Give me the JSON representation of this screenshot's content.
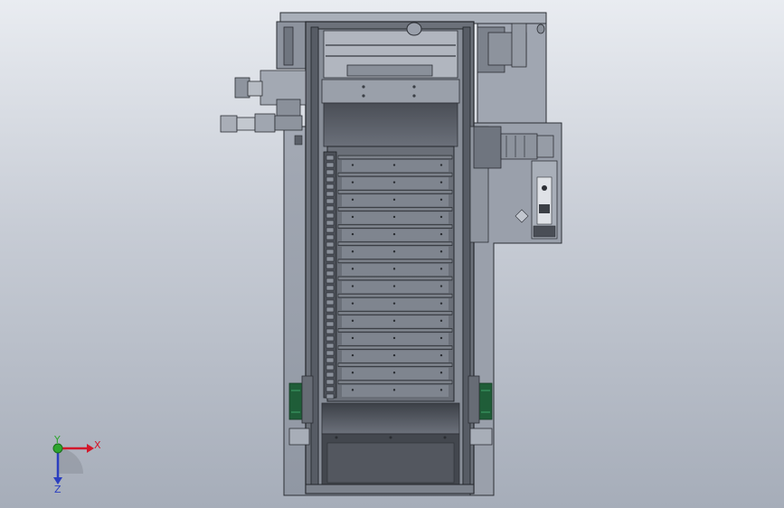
{
  "view": {
    "name": "cad-model-viewport"
  },
  "triad": {
    "x_label": "X",
    "y_label": "Y",
    "z_label": "Z",
    "x_color": "#d3172a",
    "y_color": "#2ea52e",
    "z_color": "#2b3fc0"
  },
  "model": {
    "slat_count": 14,
    "frame_color": "#5f6470",
    "panel_color": "#9aa0ab",
    "dark_color": "#3f434b",
    "highlight_color": "#7a808b"
  }
}
